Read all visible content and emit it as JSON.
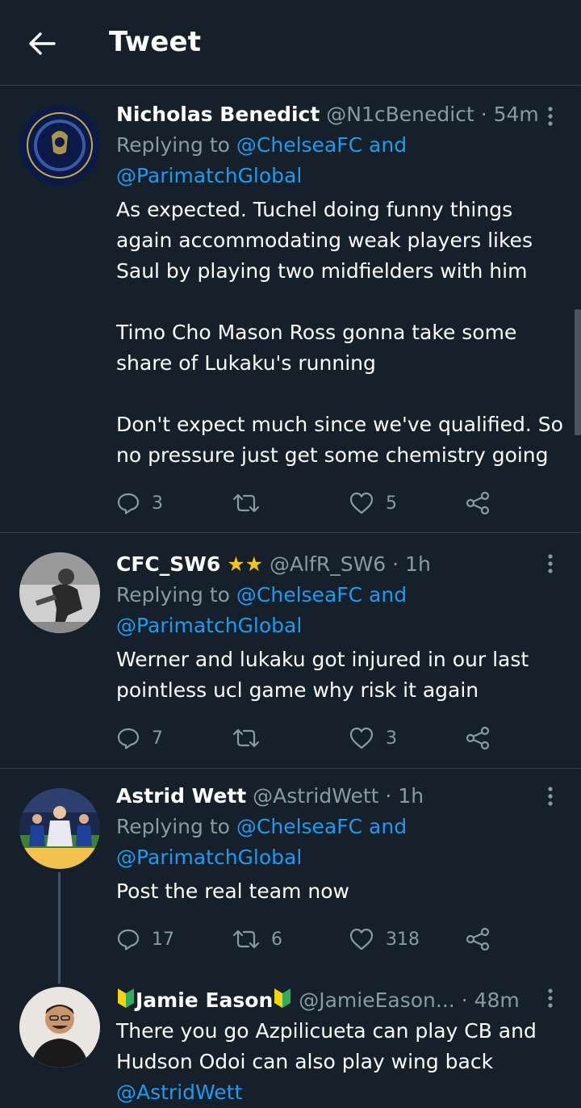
{
  "header": {
    "title": "Tweet"
  },
  "tweets": [
    {
      "name": "Nicholas Benedict",
      "handle": "@N1cBenedict",
      "time": "· 54m",
      "replying_prefix": "Replying to",
      "replying_link_1": "@ChelseaFC and",
      "replying_link_2": "@ParimatchGlobal",
      "body": "As expected. Tuchel doing funny things again accommodating weak players likes Saul by playing two midfielders with him\n\nTimo Cho Mason Ross gonna take some share of Lukaku's running\n\nDon't expect much since we've qualified. So no pressure just get some chemistry going",
      "replies": "3",
      "retweets": "",
      "likes": "5"
    },
    {
      "name": "CFC_SW6",
      "name_stars": "★★",
      "handle": "@AlfR_SW6",
      "time": "· 1h",
      "replying_prefix": "Replying to",
      "replying_link_1": "@ChelseaFC and",
      "replying_link_2": "@ParimatchGlobal",
      "body": "Werner and lukaku got injured in our last pointless ucl game why risk it again",
      "replies": "7",
      "retweets": "",
      "likes": "3"
    },
    {
      "name": "Astrid Wett",
      "handle": "@AstridWett",
      "time": "· 1h",
      "replying_prefix": "Replying to",
      "replying_link_1": "@ChelseaFC and",
      "replying_link_2": "@ParimatchGlobal",
      "body": "Post the real team now",
      "replies": "17",
      "retweets": "6",
      "likes": "318"
    },
    {
      "name": "Jamie Eason",
      "handle": "@JamieEason...",
      "time": "· 48m",
      "body": "There you go Azpilicueta can play CB and Hudson Odoi can also play wing back",
      "mention": "@AstridWett"
    }
  ]
}
